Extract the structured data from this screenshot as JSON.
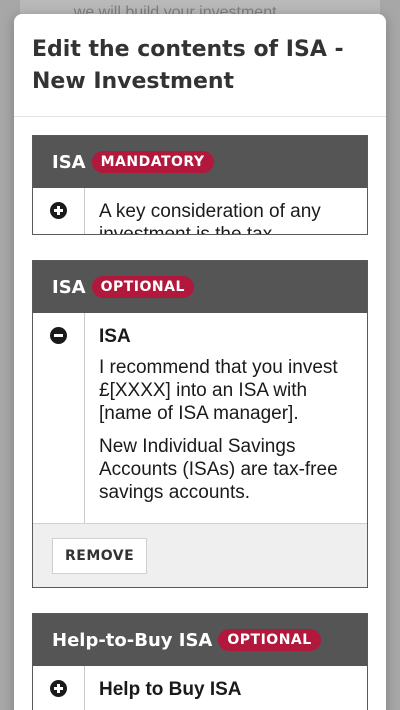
{
  "backdrop": {
    "text": "... we will build your investment..."
  },
  "modal": {
    "title": "Edit the contents of ISA - New Investment"
  },
  "sections": [
    {
      "title": "ISA",
      "badge": "MANDATORY",
      "toggle": "plus-icon",
      "content": {
        "text": "A key consideration of any investment is the tax"
      }
    },
    {
      "title": "ISA",
      "badge": "OPTIONAL",
      "toggle": "minus-icon",
      "content": {
        "heading": "ISA",
        "p1": "I recommend that you invest £[XXXX] into an ISA with [name of ISA manager].",
        "p2": "New Individual Savings Accounts (ISAs) are tax-free savings accounts."
      },
      "remove_label": "REMOVE"
    },
    {
      "title": "Help-to-Buy ISA",
      "badge": "OPTIONAL",
      "toggle": "plus-icon",
      "content": {
        "heading": "Help to Buy ISA"
      }
    }
  ],
  "colors": {
    "header_bg": "#555555",
    "badge_bg": "#b2173c",
    "text": "#333333"
  }
}
